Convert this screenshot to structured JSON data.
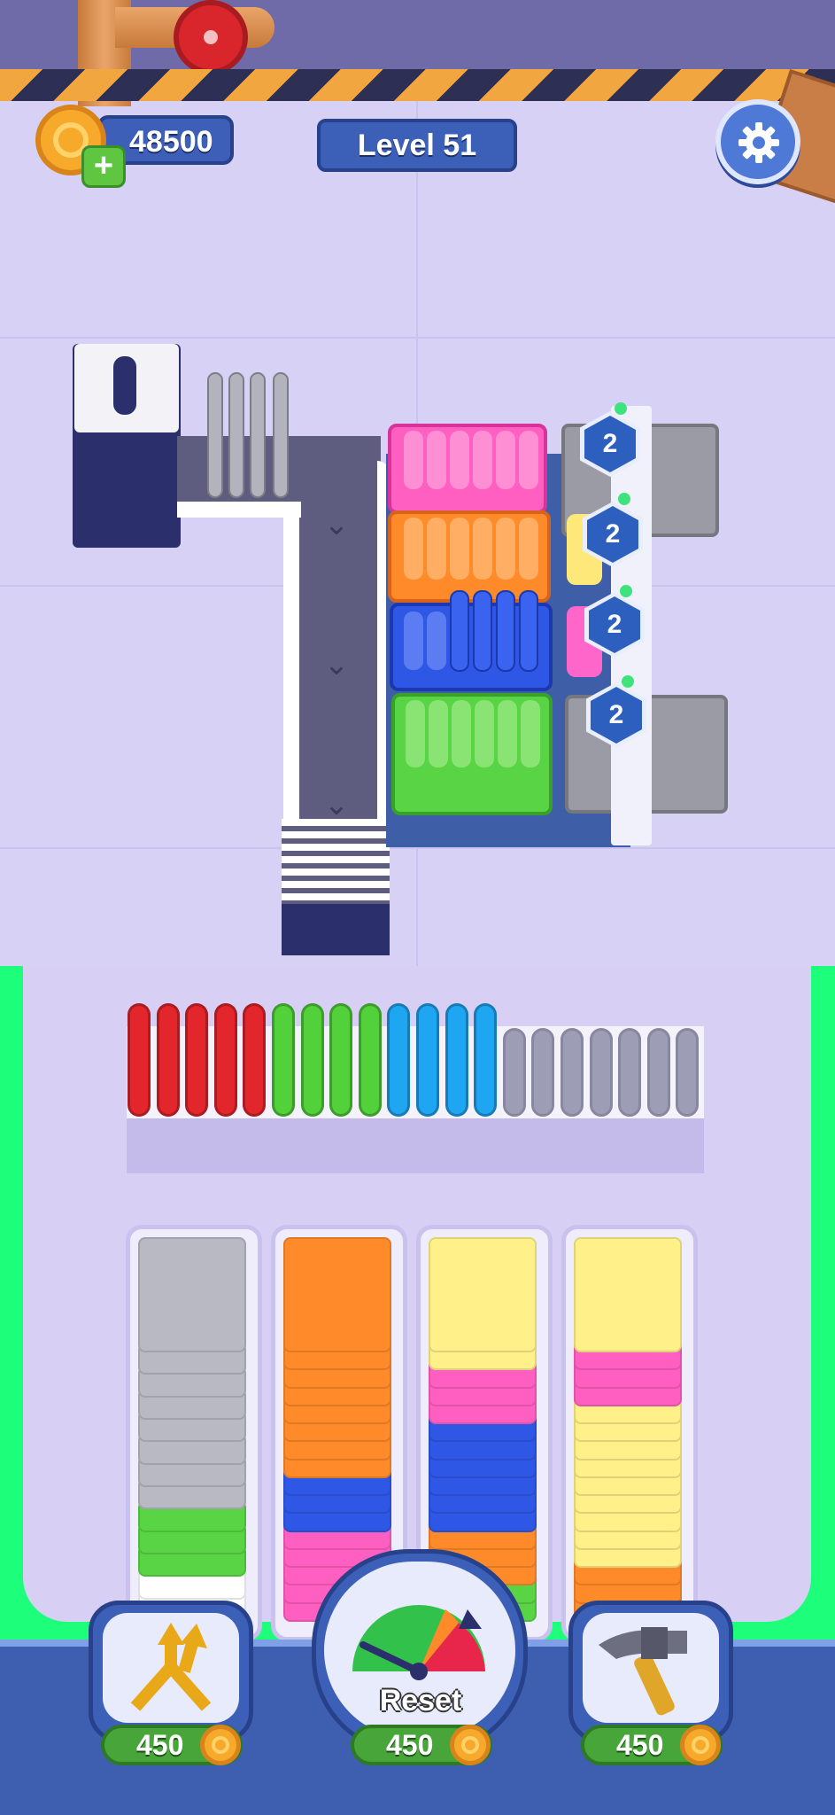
{
  "hud": {
    "coins": "48500",
    "add_coins_symbol": "+",
    "level_label": "Level 51",
    "settings_icon": "gear-icon"
  },
  "board": {
    "shelves": [
      {
        "color": "#ff5fc0",
        "name": "pink"
      },
      {
        "color": "#ff8a2a",
        "name": "orange"
      },
      {
        "color": "#2f57e6",
        "name": "blue"
      },
      {
        "color": "#59d445",
        "name": "green"
      }
    ],
    "lock_badges": [
      "2",
      "2",
      "2",
      "2"
    ],
    "conveyor_icon": "chevron-down-icon"
  },
  "queue": {
    "filled": [
      {
        "color": "#e3262c",
        "count": 5
      },
      {
        "color": "#52d13a",
        "count": 4
      },
      {
        "color": "#1fa6f2",
        "count": 4
      }
    ],
    "empty_slots": 7
  },
  "stacks": [
    {
      "top_color": "#b9b9c3"
    },
    {
      "top_color": "#ff8a2a"
    },
    {
      "top_color": "#fff08a"
    },
    {
      "top_color": "#fff08a"
    }
  ],
  "boosters": {
    "shuffle": {
      "icon": "shuffle-arrows-icon",
      "price": "450"
    },
    "reset": {
      "icon": "gauge-icon",
      "label": "Reset",
      "price": "450"
    },
    "hammer": {
      "icon": "hammer-icon",
      "price": "450"
    }
  }
}
